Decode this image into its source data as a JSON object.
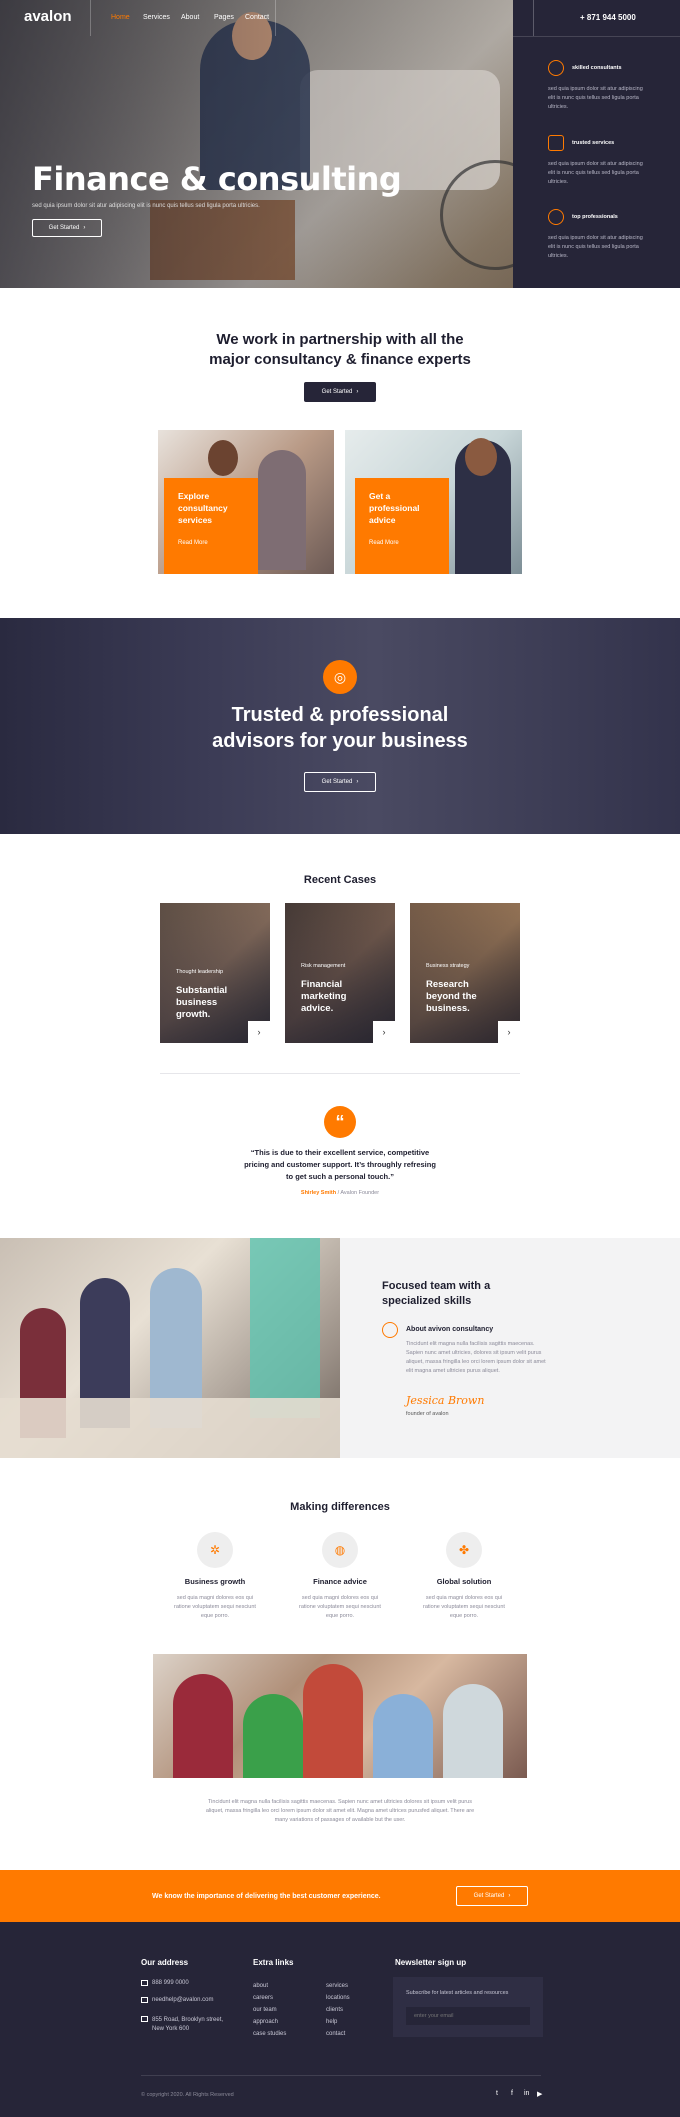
{
  "header": {
    "logo": "avalon",
    "nav": [
      "Home",
      "Services",
      "About",
      "Pages",
      "Contact"
    ],
    "phone": "+ 871 944 5000"
  },
  "hero": {
    "title": "Finance & consulting",
    "subtitle": "sed quia ipsum dolor sit atur adipiscing elit is nunc quis tellus sed ligula porta ultricies.",
    "cta": "Get Started",
    "features": [
      {
        "icon": "users-icon",
        "title": "skilled consultants",
        "text": "sed quia ipsum dolor sit atur adipiscing elit is nunc quis tellus sed ligula porta ultricies."
      },
      {
        "icon": "puzzle-icon",
        "title": "trusted services",
        "text": "sed quia ipsum dolor sit atur adipiscing elit is nunc quis tellus sed ligula porta ultricies."
      },
      {
        "icon": "globe-icon",
        "title": "top professionals",
        "text": "sed quia ipsum dolor sit atur adipiscing elit is nunc quis tellus sed ligula porta ultricies."
      }
    ]
  },
  "partnership": {
    "title_line1": "We work in partnership with all the",
    "title_line2": "major consultancy & finance experts",
    "cta": "Get Started",
    "cards": [
      {
        "line1": "Explore",
        "line2": "consultancy",
        "line3": "services",
        "link": "Read More"
      },
      {
        "line1": "Get a",
        "line2": "professional",
        "line3": "advice",
        "link": "Read More"
      }
    ]
  },
  "trusted": {
    "title_line1": "Trusted & professional",
    "title_line2": "advisors for your business",
    "cta": "Get Started"
  },
  "cases": {
    "title": "Recent Cases",
    "items": [
      {
        "tag": "Thought leadership",
        "line1": "Substantial",
        "line2": "business",
        "line3": "growth."
      },
      {
        "tag": "Risk management",
        "line1": "Financial",
        "line2": "marketing",
        "line3": "advice."
      },
      {
        "tag": "Business strategy",
        "line1": "Research",
        "line2": "beyond the",
        "line3": "business."
      }
    ]
  },
  "testimonial": {
    "line1": "“This is due to their excellent service, competitive",
    "line2": "pricing and customer support. It’s throughly refresing",
    "line3": "to get such a personal touch.”",
    "author": "Shirley Smith",
    "role": "/ Avalon Founder"
  },
  "team": {
    "title_line1": "Focused team with a",
    "title_line2": "specialized skills",
    "sub_title": "About avivon consultancy",
    "text": "Tincidunt elit magna nulla facilisis sagittis maecenas. Sapien nunc amet ultricies, dolores sit ipsum velit purus aliquet, massa fringilla leo orci lorem ipsum dolor sit amet elit magna amet ultricies purus aliquet.",
    "signature": "Jessica Brown",
    "signature_role": "founder of avalon"
  },
  "differences": {
    "title": "Making differences",
    "items": [
      {
        "icon": "gear-icon",
        "title": "Business growth",
        "text": "sed quia magni dolores eos qui ratione voluptatem sequi nesciunt eque porro."
      },
      {
        "icon": "globe-icon",
        "title": "Finance advice",
        "text": "sed quia magni dolores eos qui ratione voluptatem sequi nesciunt eque porro."
      },
      {
        "icon": "puzzle-icon",
        "title": "Global solution",
        "text": "sed quia magni dolores eos qui ratione voluptatem sequi nesciunt eque porro."
      }
    ],
    "paragraph_line1": "Tincidunt elit magna nulla facilisis sagittis maecenas. Sapien nunc amet ultricies dolores sit ipsum velit purus",
    "paragraph_line2": "aliquet, massa fringilla leo orci lorem ipsum dolor sit amet elit. Magna amet ultrices purusfed aliquet. There are",
    "paragraph_line3": "many variations of passages of available but the user."
  },
  "cta_bar": {
    "text": "We know the importance of delivering the best customer experience.",
    "button": "Get Started"
  },
  "footer": {
    "address_title": "Our address",
    "phone": "888 999 0000",
    "email": "needhelp@avalon.com",
    "address_line1": "855 Road, Brooklyn street,",
    "address_line2": "New York 600",
    "links_title": "Extra links",
    "links_col1": [
      "about",
      "careers",
      "our team",
      "approach",
      "case studies"
    ],
    "links_col2": [
      "services",
      "locations",
      "clients",
      "help",
      "contact"
    ],
    "newsletter_title": "Newsletter sign up",
    "newsletter_text": "Subscribe for latest articles and resources",
    "newsletter_placeholder": "enter your email",
    "copyright": "© copyright 2020. All Rights Reserved"
  },
  "colors": {
    "accent": "#ff7a00",
    "dark": "#262538"
  }
}
